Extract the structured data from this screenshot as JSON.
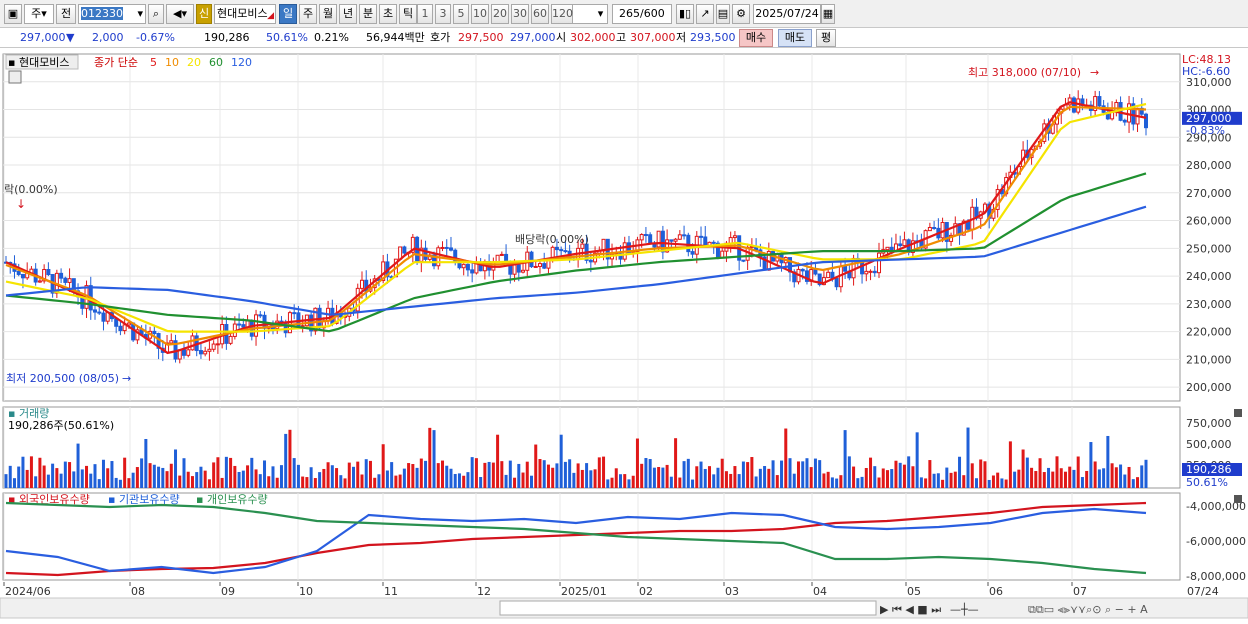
{
  "toolbar": {
    "period_type": "주",
    "prev_label": "전",
    "code": "012330",
    "new_label": "신",
    "name": "현대모비스",
    "periods": [
      "일",
      "주",
      "월",
      "년",
      "분",
      "초",
      "틱"
    ],
    "active_period": "일",
    "multiples": [
      "1",
      "3",
      "5",
      "10",
      "20",
      "30",
      "60",
      "120"
    ],
    "count": "265",
    "count_total": "/600",
    "date": "2025/07/24"
  },
  "quote": {
    "price": "297,000",
    "change": "2,000",
    "change_pct": "-0.67%",
    "volume": "190,286",
    "volume_ratio": "50.61%",
    "turnover_pct": "0.21%",
    "amount": "56,944백만",
    "bid_label": "호가",
    "bid": "297,500",
    "ask": "297,000",
    "open_label": "시",
    "open": "302,000",
    "high_label": "고",
    "high": "307,000",
    "low_label": "저",
    "low": "293,500",
    "buy_label": "매수",
    "sell_label": "매도",
    "eval_label": "평"
  },
  "price_panel": {
    "stock_name": "현대모비스",
    "legend_prefix": "종가 단순",
    "ma_periods": [
      "5",
      "10",
      "20",
      "60",
      "120"
    ],
    "ma_colors": [
      "#e01818",
      "#f08c00",
      "#f5e400",
      "#209030",
      "#2a5ee0"
    ],
    "lc": "LC:48.13",
    "hc": "HC:-6.60",
    "high_annotation": "최고 318,000 (07/10)",
    "low_annotation": "최저 200,500 (08/05)",
    "dividend_label_1": "락(0.00%)",
    "dividend_label_2": "배당락(0.00%)",
    "current_price": "297,000",
    "current_change": "-0.83%",
    "y_ticks": [
      "310,000",
      "300,000",
      "290,000",
      "280,000",
      "270,000",
      "260,000",
      "250,000",
      "240,000",
      "230,000",
      "220,000",
      "210,000",
      "200,000"
    ]
  },
  "volume_panel": {
    "title": "거래량",
    "value": "190,286주(50.61%)",
    "y_ticks": [
      "750,000",
      "500,000",
      "250,000"
    ],
    "current": "190,286",
    "current_ratio": "50.61%"
  },
  "holding_panel": {
    "foreign": "외국인보유수량",
    "institution": "기관보유수량",
    "individual": "개인보유수량",
    "y_ticks": [
      "-4,000,000",
      "-6,000,000",
      "-8,000,000"
    ]
  },
  "x_axis": [
    "2024/06",
    "08",
    "09",
    "10",
    "11",
    "12",
    "2025/01",
    "02",
    "03",
    "04",
    "05",
    "06",
    "07",
    "07/24"
  ],
  "chart_data": {
    "type": "line",
    "x": [
      "2024-06",
      "2024-07",
      "2024-08",
      "2024-09",
      "2024-10",
      "2024-11",
      "2024-12",
      "2025-01",
      "2025-02",
      "2025-03",
      "2025-04",
      "2025-05",
      "2025-06",
      "2025-07",
      "2025-07-24"
    ],
    "series": [
      {
        "name": "5",
        "values": [
          245000,
          232000,
          212000,
          222000,
          225000,
          250000,
          243000,
          248000,
          252000,
          250000,
          237000,
          250000,
          262000,
          303000,
          297000
        ]
      },
      {
        "name": "10",
        "values": [
          244000,
          233000,
          215000,
          221000,
          224000,
          248000,
          244000,
          247000,
          250000,
          251000,
          242000,
          248000,
          258000,
          301000,
          300000
        ]
      },
      {
        "name": "20",
        "values": [
          238000,
          232000,
          220000,
          220000,
          222000,
          245000,
          245000,
          246000,
          249000,
          252000,
          246000,
          246000,
          252000,
          295000,
          302000
        ]
      },
      {
        "name": "60",
        "values": [
          233000,
          230000,
          226000,
          224000,
          220000,
          232000,
          238000,
          242000,
          245000,
          247000,
          249000,
          249000,
          250000,
          268000,
          277000
        ]
      },
      {
        "name": "120",
        "values": [
          233000,
          236000,
          235000,
          231000,
          226000,
          229000,
          232000,
          234000,
          237000,
          241000,
          245000,
          246000,
          247000,
          256000,
          265000
        ]
      }
    ],
    "ylim": [
      195000,
      320000
    ]
  }
}
